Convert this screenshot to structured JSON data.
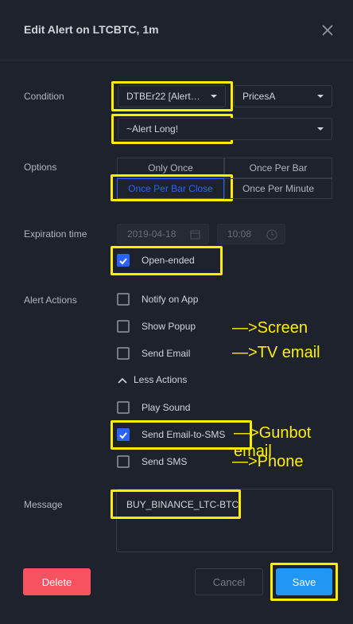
{
  "dialog": {
    "title": "Edit Alert on LTCBTC, 1m"
  },
  "condition": {
    "label": "Condition",
    "indicator": "DTBEr22 [Alert…",
    "source": "PricesA",
    "alert": "~Alert Long!",
    "second": ""
  },
  "options": {
    "label": "Options",
    "choices": [
      "Only Once",
      "Once Per Bar",
      "Once Per Bar Close",
      "Once Per Minute"
    ],
    "selected": "Once Per Bar Close"
  },
  "expiration": {
    "label": "Expiration time",
    "date": "2019-04-18",
    "time": "10:08",
    "open_ended_label": "Open-ended",
    "open_ended_checked": true
  },
  "alert_actions": {
    "label": "Alert Actions",
    "notify_app": "Notify on App",
    "show_popup": "Show Popup",
    "send_email": "Send Email",
    "less_actions": "Less Actions",
    "play_sound": "Play Sound",
    "send_email_sms": "Send Email-to-SMS",
    "send_sms": "Send SMS",
    "notes": {
      "popup": "—>Screen",
      "email": "—>TV email",
      "email_sms": "—>Gunbot email",
      "sms": "—>Phone"
    }
  },
  "message": {
    "label": "Message",
    "value": "BUY_BINANCE_LTC-BTC"
  },
  "footer": {
    "delete": "Delete",
    "cancel": "Cancel",
    "save": "Save"
  },
  "colors": {
    "background": "#1e222d",
    "accent": "#2962ff",
    "highlight": "#ffee00",
    "delete": "#f7525f"
  }
}
